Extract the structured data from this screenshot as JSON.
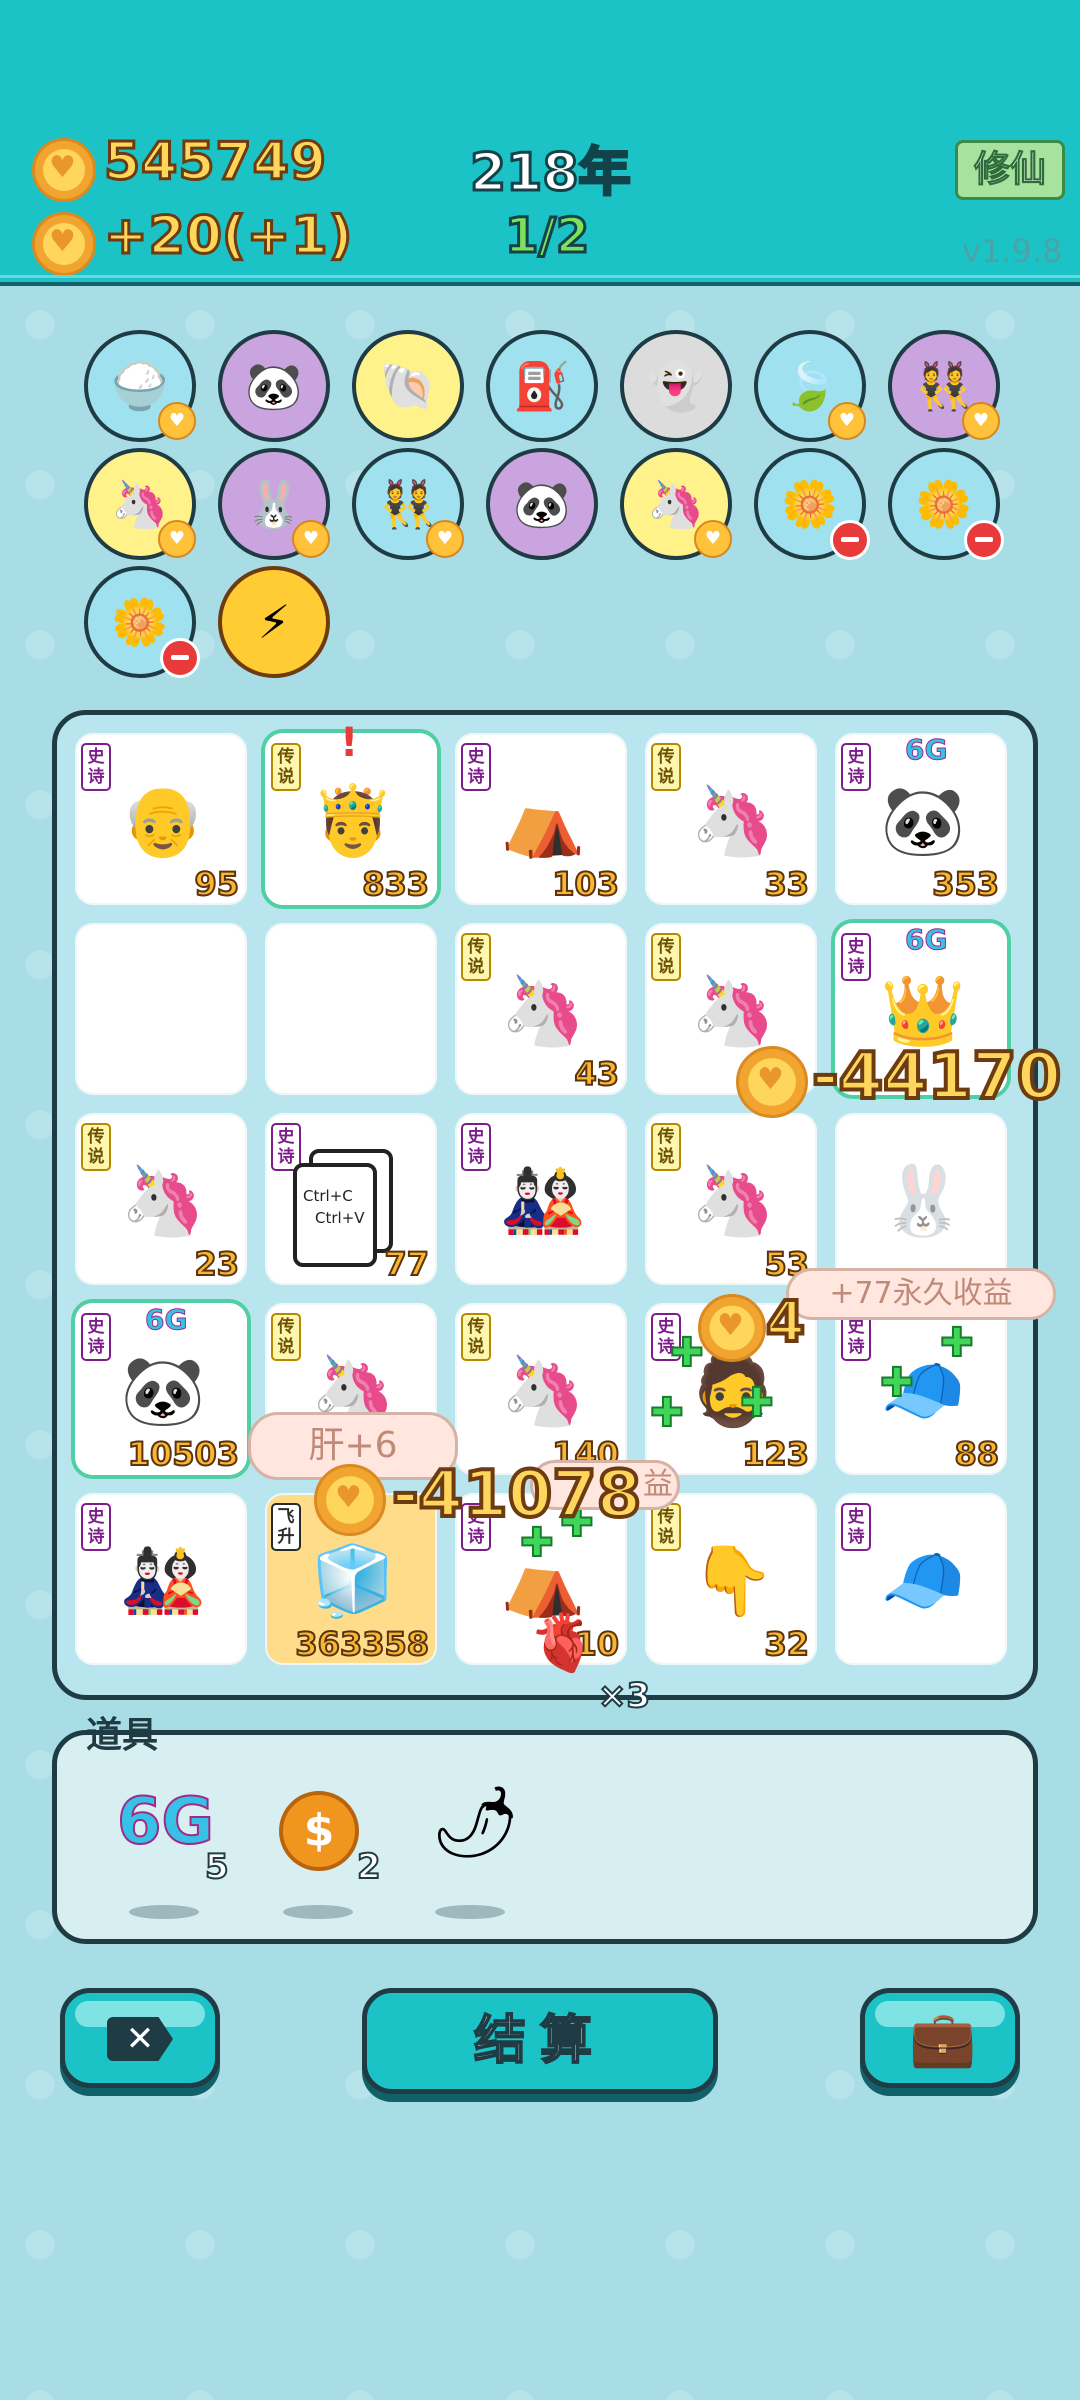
{
  "header": {
    "coins": "545749",
    "income": "+20",
    "income_bonus": "(+1)",
    "year": "218年",
    "turns": "1/2",
    "xiuxian_label": "修仙",
    "version": "v1.9.8"
  },
  "board": {
    "rows": [
      [
        {
          "tag": "史诗",
          "num": "95"
        },
        {
          "tag": "传说",
          "num": "833"
        },
        {
          "tag": "史诗",
          "num": "103"
        },
        {
          "tag": "传说",
          "num": "33"
        },
        {
          "tag": "史诗",
          "num": "353"
        }
      ],
      [
        {
          "tag": "",
          "num": ""
        },
        {
          "tag": "",
          "num": ""
        },
        {
          "tag": "传说",
          "num": "43"
        },
        {
          "tag": "传说",
          "num": ""
        },
        {
          "tag": "史诗",
          "num": ""
        }
      ],
      [
        {
          "tag": "传说",
          "num": "23"
        },
        {
          "tag": "史诗",
          "num": "77"
        },
        {
          "tag": "史诗",
          "num": ""
        },
        {
          "tag": "传说",
          "num": "53"
        },
        {
          "tag": "",
          "num": ""
        }
      ],
      [
        {
          "tag": "史诗",
          "num": "10503"
        },
        {
          "tag": "传说",
          "num": ""
        },
        {
          "tag": "传说",
          "num": "140"
        },
        {
          "tag": "史诗",
          "num": "123"
        },
        {
          "tag": "史诗",
          "num": "88"
        }
      ],
      [
        {
          "tag": "史诗",
          "num": ""
        },
        {
          "tag": "飞升",
          "num": "363358"
        },
        {
          "tag": "史诗",
          "num": "10"
        },
        {
          "tag": "传说",
          "num": "32"
        },
        {
          "tag": "史诗",
          "num": ""
        }
      ]
    ],
    "copy_text_1": "Ctrl+C",
    "copy_text_2": "Ctrl+V",
    "g6_label": "6G"
  },
  "effects": {
    "float_a": "-44170",
    "float_b": "-41078",
    "float_c": "4",
    "bubble_perm": "+77永久收益",
    "bubble_liver": "肝+6",
    "bubble_small": "益",
    "times": "×3"
  },
  "items": {
    "title": "道具",
    "list": [
      {
        "label": "6G",
        "count": "5"
      },
      {
        "label": "$",
        "count": "2"
      },
      {
        "label": "",
        "count": ""
      }
    ]
  },
  "buttons": {
    "settle": "结算"
  }
}
